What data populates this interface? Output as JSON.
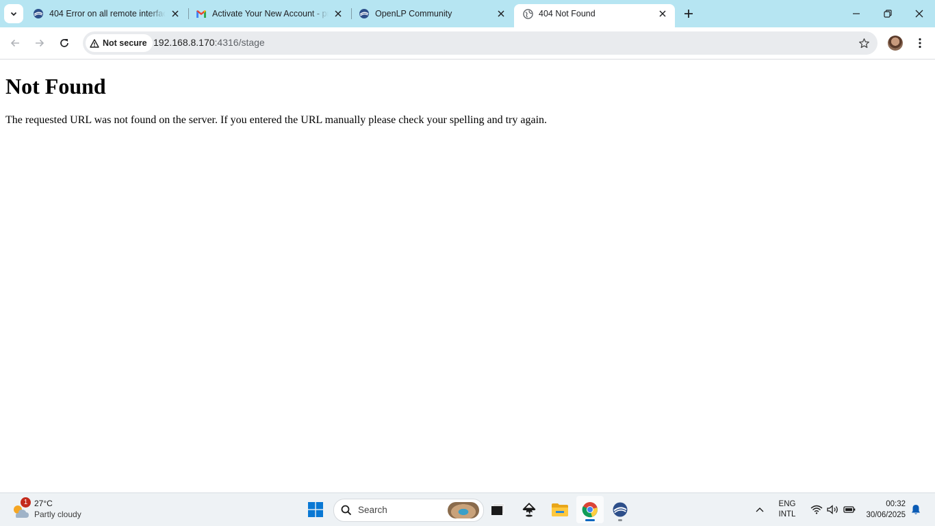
{
  "tabs": [
    {
      "title": "404 Error on all remote interface",
      "icon": "openlp-icon",
      "active": false
    },
    {
      "title": "Activate Your New Account - pr",
      "icon": "gmail-icon",
      "active": false
    },
    {
      "title": "OpenLP Community",
      "icon": "openlp-icon",
      "active": false
    },
    {
      "title": "404 Not Found",
      "icon": "globe-icon",
      "active": true
    }
  ],
  "omnibox": {
    "security_label": "Not secure",
    "url_host": "192.168.8.170",
    "url_path": ":4316/stage"
  },
  "page": {
    "heading": "Not Found",
    "message": "The requested URL was not found on the server. If you entered the URL manually please check your spelling and try again."
  },
  "taskbar": {
    "weather": {
      "temperature": "27°C",
      "condition": "Partly cloudy",
      "badge": "1"
    },
    "search_label": "Search",
    "language": {
      "line1": "ENG",
      "line2": "INTL"
    },
    "clock": {
      "time": "00:32",
      "date": "30/06/2025"
    }
  },
  "colors": {
    "tabstrip": "#b6e5f2",
    "accent": "#0067c0"
  }
}
